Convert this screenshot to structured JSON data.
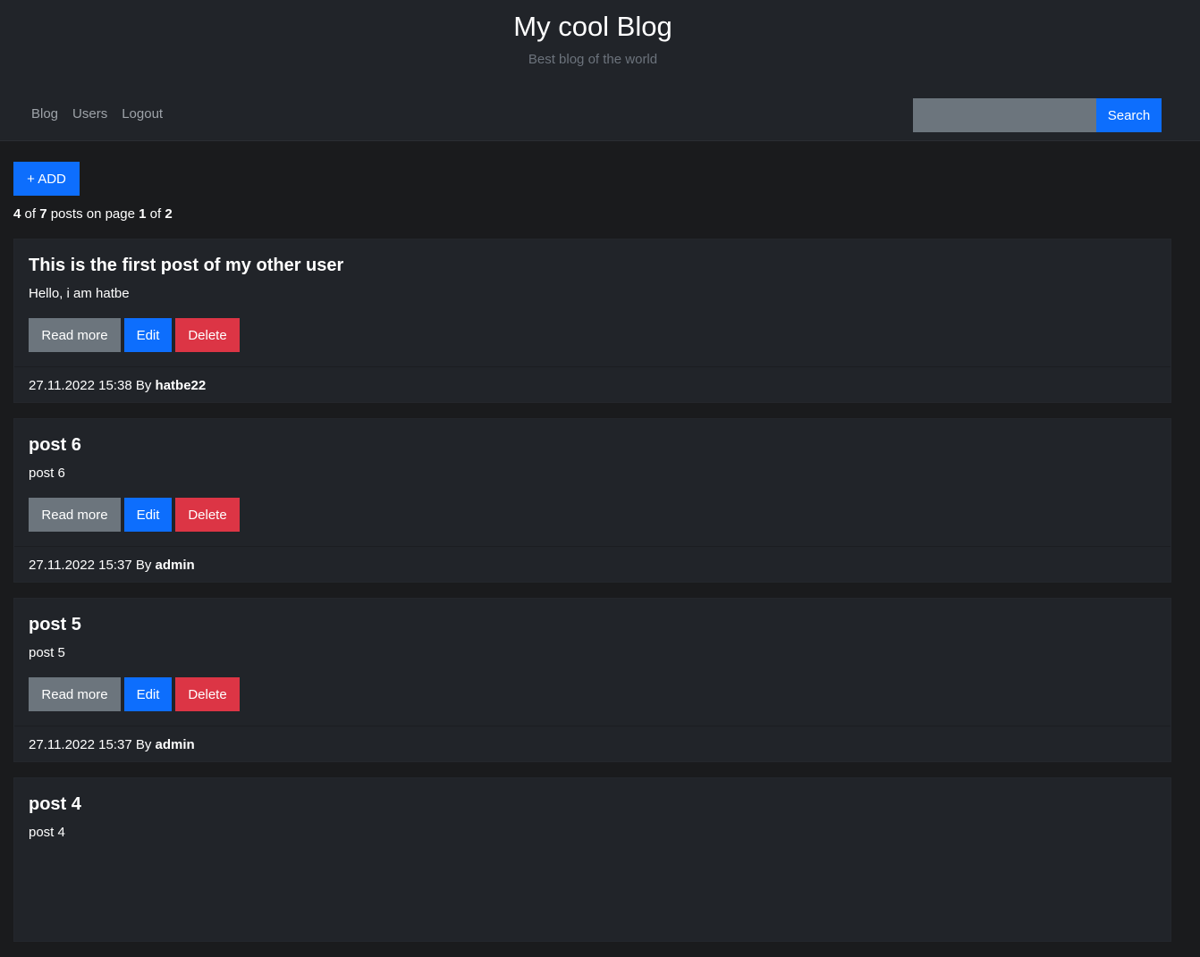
{
  "header": {
    "title": "My cool Blog",
    "subtitle": "Best blog of the world"
  },
  "nav": {
    "items": [
      "Blog",
      "Users",
      "Logout"
    ]
  },
  "search": {
    "value": "",
    "placeholder": "",
    "button_label": "Search"
  },
  "toolbar": {
    "add_label": "+ ADD"
  },
  "pager": {
    "shown": "4",
    "of_word": "of",
    "total": "7",
    "posts_on_page_word": "posts on page",
    "page": "1",
    "of_word2": "of",
    "pages": "2"
  },
  "post_actions": {
    "read_more": "Read more",
    "edit": "Edit",
    "delete": "Delete",
    "by_word": "By"
  },
  "posts": [
    {
      "title": "This is the first post of my other user",
      "text": "Hello, i am hatbe",
      "date": "27.11.2022 15:38",
      "author": "hatbe22"
    },
    {
      "title": "post 6",
      "text": "post 6",
      "date": "27.11.2022 15:37",
      "author": "admin"
    },
    {
      "title": "post 5",
      "text": "post 5",
      "date": "27.11.2022 15:37",
      "author": "admin"
    },
    {
      "title": "post 4",
      "text": "post 4",
      "date": "",
      "author": ""
    }
  ]
}
